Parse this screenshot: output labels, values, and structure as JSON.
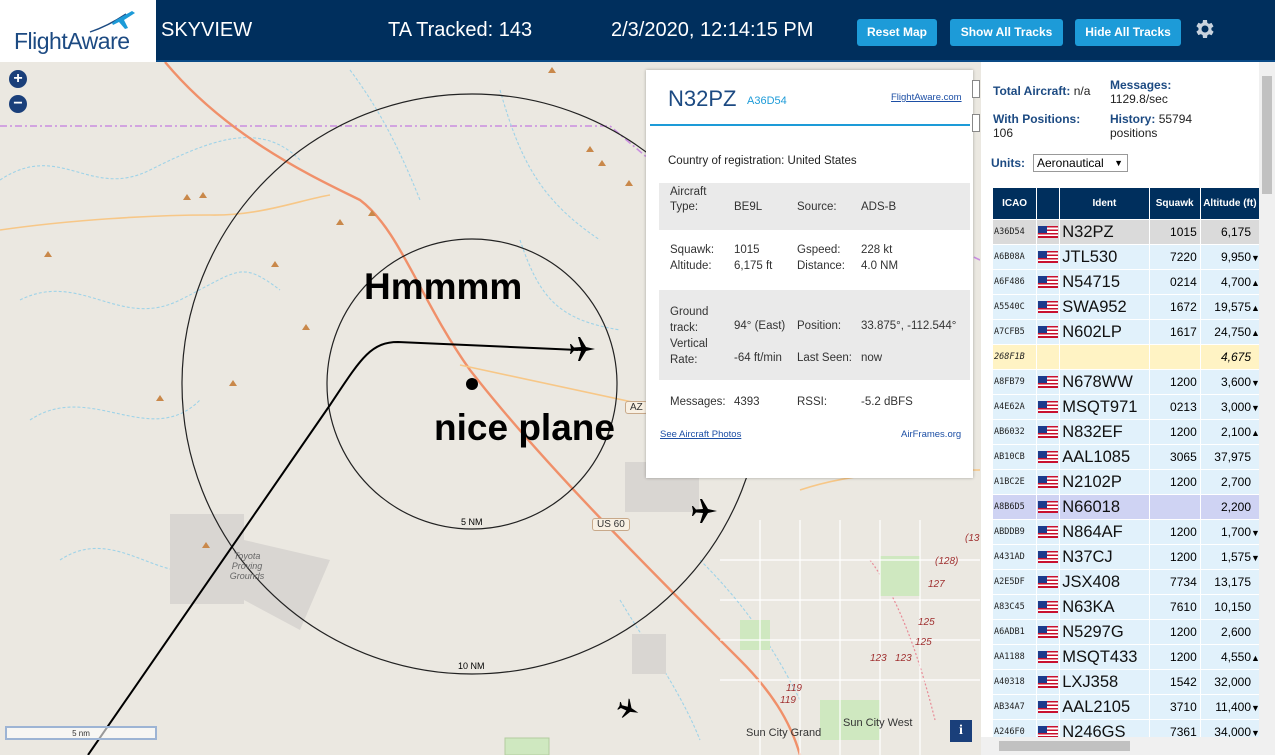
{
  "header": {
    "logo_text": "FlightAware",
    "title": "SKYVIEW",
    "ta_tracked": "TA Tracked: 143",
    "datetime": "2/3/2020, 12:14:15 PM",
    "buttons": {
      "reset": "Reset Map",
      "show_all": "Show All Tracks",
      "hide_all": "Hide All Tracks"
    },
    "settings_icon": "gear-icon"
  },
  "map": {
    "zoom_in": "+",
    "zoom_out": "−",
    "annotations": {
      "hmmmm": "Hmmmm",
      "nice_plane": "nice plane"
    },
    "rings": {
      "inner": "5 NM",
      "outer": "10 NM"
    },
    "shields": {
      "us60": "US 60",
      "az": "AZ"
    },
    "towns": {
      "sun_city_west": "Sun City West",
      "sun_city_grand": "Sun City Grand",
      "toyota": "Toyota Proving Grounds"
    },
    "route_numbers": [
      "(128)",
      "127",
      "(13",
      "125",
      "125",
      "123",
      "123",
      "119",
      "119"
    ],
    "scalebar": "5 nm",
    "info_button": "i"
  },
  "selected": {
    "ident": "N32PZ",
    "icao": "A36D54",
    "fa_link": "FlightAware.com",
    "country_label": "Country of registration:",
    "country": "United States",
    "aircraft_type_label": "Aircraft Type:",
    "aircraft_type": "BE9L",
    "source_label": "Source:",
    "source": "ADS-B",
    "squawk_label": "Squawk:",
    "squawk": "1015",
    "gspeed_label": "Gspeed:",
    "gspeed": "228 kt",
    "altitude_label": "Altitude:",
    "altitude": "6,175 ft",
    "distance_label": "Distance:",
    "distance": "4.0 NM",
    "ground_track_label": "Ground track:",
    "ground_track": "94° (East)",
    "position_label": "Position:",
    "position": "33.875°, -112.544°",
    "vertical_rate_label": "Vertical Rate:",
    "vertical_rate": "-64 ft/min",
    "last_seen_label": "Last Seen:",
    "last_seen": "now",
    "messages_label": "Messages:",
    "messages": "4393",
    "rssi_label": "RSSI:",
    "rssi": "-5.2 dBFS",
    "photos_link": "See Aircraft Photos",
    "airframes_link": "AirFrames.org"
  },
  "sidebar": {
    "total_aircraft_label": "Total Aircraft:",
    "total_aircraft": "n/a",
    "messages_label": "Messages:",
    "messages_rate": "1129.8/sec",
    "with_positions_label": "With Positions:",
    "with_positions": "106",
    "history_label": "History:",
    "history": "55794 positions",
    "units_label": "Units:",
    "units_value": "Aeronautical"
  },
  "table": {
    "headers": {
      "icao": "ICAO",
      "ident": "Ident",
      "squawk": "Squawk",
      "altitude": "Altitude (ft)"
    },
    "rows": [
      {
        "icao": "A36D54",
        "flag": true,
        "ident": "N32PZ",
        "squawk": "1015",
        "alt": "6,175",
        "trend": "",
        "state": "selected"
      },
      {
        "icao": "A6B08A",
        "flag": true,
        "ident": "JTL530",
        "squawk": "7220",
        "alt": "9,950",
        "trend": "▼",
        "state": ""
      },
      {
        "icao": "A6F486",
        "flag": true,
        "ident": "N54715",
        "squawk": "0214",
        "alt": "4,700",
        "trend": "▲",
        "state": ""
      },
      {
        "icao": "A5540C",
        "flag": true,
        "ident": "SWA952",
        "squawk": "1672",
        "alt": "19,575",
        "trend": "▲",
        "state": ""
      },
      {
        "icao": "A7CFB5",
        "flag": true,
        "ident": "N602LP",
        "squawk": "1617",
        "alt": "24,750",
        "trend": "▲",
        "state": ""
      },
      {
        "icao": "268F1B",
        "flag": false,
        "ident": "",
        "squawk": "",
        "alt": "4,675",
        "trend": "",
        "state": "mlat"
      },
      {
        "icao": "A8FB79",
        "flag": true,
        "ident": "N678WW",
        "squawk": "1200",
        "alt": "3,600",
        "trend": "▼",
        "state": ""
      },
      {
        "icao": "A4E62A",
        "flag": true,
        "ident": "MSQT971",
        "squawk": "0213",
        "alt": "3,000",
        "trend": "▼",
        "state": ""
      },
      {
        "icao": "AB6032",
        "flag": true,
        "ident": "N832EF",
        "squawk": "1200",
        "alt": "2,100",
        "trend": "▲",
        "state": ""
      },
      {
        "icao": "AB10CB",
        "flag": true,
        "ident": "AAL1085",
        "squawk": "3065",
        "alt": "37,975",
        "trend": "",
        "state": ""
      },
      {
        "icao": "A1BC2E",
        "flag": true,
        "ident": "N2102P",
        "squawk": "1200",
        "alt": "2,700",
        "trend": "",
        "state": ""
      },
      {
        "icao": "A8B6D5",
        "flag": true,
        "ident": "N66018",
        "squawk": "",
        "alt": "2,200",
        "trend": "",
        "state": "highlight"
      },
      {
        "icao": "ABDDB9",
        "flag": true,
        "ident": "N864AF",
        "squawk": "1200",
        "alt": "1,700",
        "trend": "▼",
        "state": ""
      },
      {
        "icao": "A431AD",
        "flag": true,
        "ident": "N37CJ",
        "squawk": "1200",
        "alt": "1,575",
        "trend": "▼",
        "state": ""
      },
      {
        "icao": "A2E5DF",
        "flag": true,
        "ident": "JSX408",
        "squawk": "7734",
        "alt": "13,175",
        "trend": "",
        "state": ""
      },
      {
        "icao": "A83C45",
        "flag": true,
        "ident": "N63KA",
        "squawk": "7610",
        "alt": "10,150",
        "trend": "",
        "state": ""
      },
      {
        "icao": "A6ADB1",
        "flag": true,
        "ident": "N5297G",
        "squawk": "1200",
        "alt": "2,600",
        "trend": "",
        "state": ""
      },
      {
        "icao": "AA1188",
        "flag": true,
        "ident": "MSQT433",
        "squawk": "1200",
        "alt": "4,550",
        "trend": "▲",
        "state": ""
      },
      {
        "icao": "A40318",
        "flag": true,
        "ident": "LXJ358",
        "squawk": "1542",
        "alt": "32,000",
        "trend": "",
        "state": ""
      },
      {
        "icao": "AB34A7",
        "flag": true,
        "ident": "AAL2105",
        "squawk": "3710",
        "alt": "11,400",
        "trend": "▼",
        "state": ""
      },
      {
        "icao": "A246F0",
        "flag": true,
        "ident": "N246GS",
        "squawk": "7361",
        "alt": "34,000",
        "trend": "▼",
        "state": ""
      }
    ]
  },
  "colors": {
    "header_bg": "#002f5d",
    "button": "#1d9bd8",
    "row_bg": "#e1f1fb",
    "selected_row": "#dadada",
    "mlat_row": "#fff3c4",
    "highlight_row": "#cfd3f3",
    "road_orange": "#f0906a"
  }
}
